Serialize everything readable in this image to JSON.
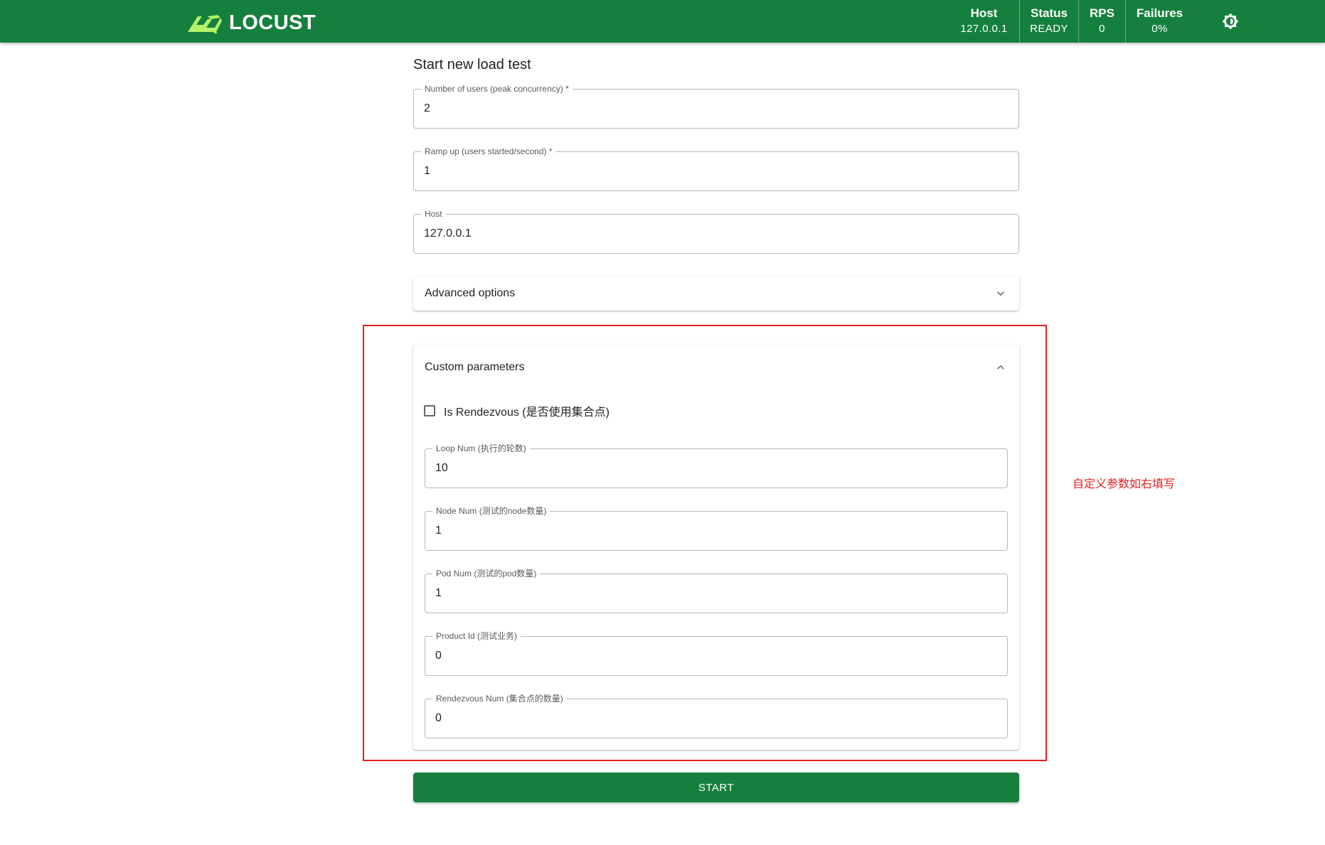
{
  "header": {
    "logo_text": "LOCUST",
    "stats": [
      {
        "label": "Host",
        "value": "127.0.0.1"
      },
      {
        "label": "Status",
        "value": "READY"
      },
      {
        "label": "RPS",
        "value": "0"
      },
      {
        "label": "Failures",
        "value": "0%"
      }
    ],
    "theme_icon": "brightness-icon"
  },
  "form": {
    "title": "Start new load test",
    "fields": [
      {
        "label": "Number of users (peak concurrency) *",
        "value": "2"
      },
      {
        "label": "Ramp up (users started/second) *",
        "value": "1"
      },
      {
        "label": "Host",
        "value": "127.0.0.1"
      }
    ],
    "advanced": {
      "label": "Advanced options",
      "icon": "chevron-down-icon"
    },
    "custom": {
      "label": "Custom parameters",
      "icon": "chevron-up-icon",
      "checkbox": {
        "label": "Is Rendezvous (是否使用集合点)",
        "checked": false
      },
      "fields": [
        {
          "label": "Loop Num (执行的轮数)",
          "value": "10"
        },
        {
          "label": "Node Num (测试的node数量)",
          "value": "1"
        },
        {
          "label": "Pod Num (测试的pod数量)",
          "value": "1"
        },
        {
          "label": "Product Id (测试业务)",
          "value": "0"
        },
        {
          "label": "Rendezvous Num (集合点的数量)",
          "value": "0"
        }
      ]
    },
    "start_label": "START"
  },
  "annotation": {
    "text": "自定义参数如右填写",
    "color": "#e02020"
  },
  "colors": {
    "brand": "#15803d"
  }
}
